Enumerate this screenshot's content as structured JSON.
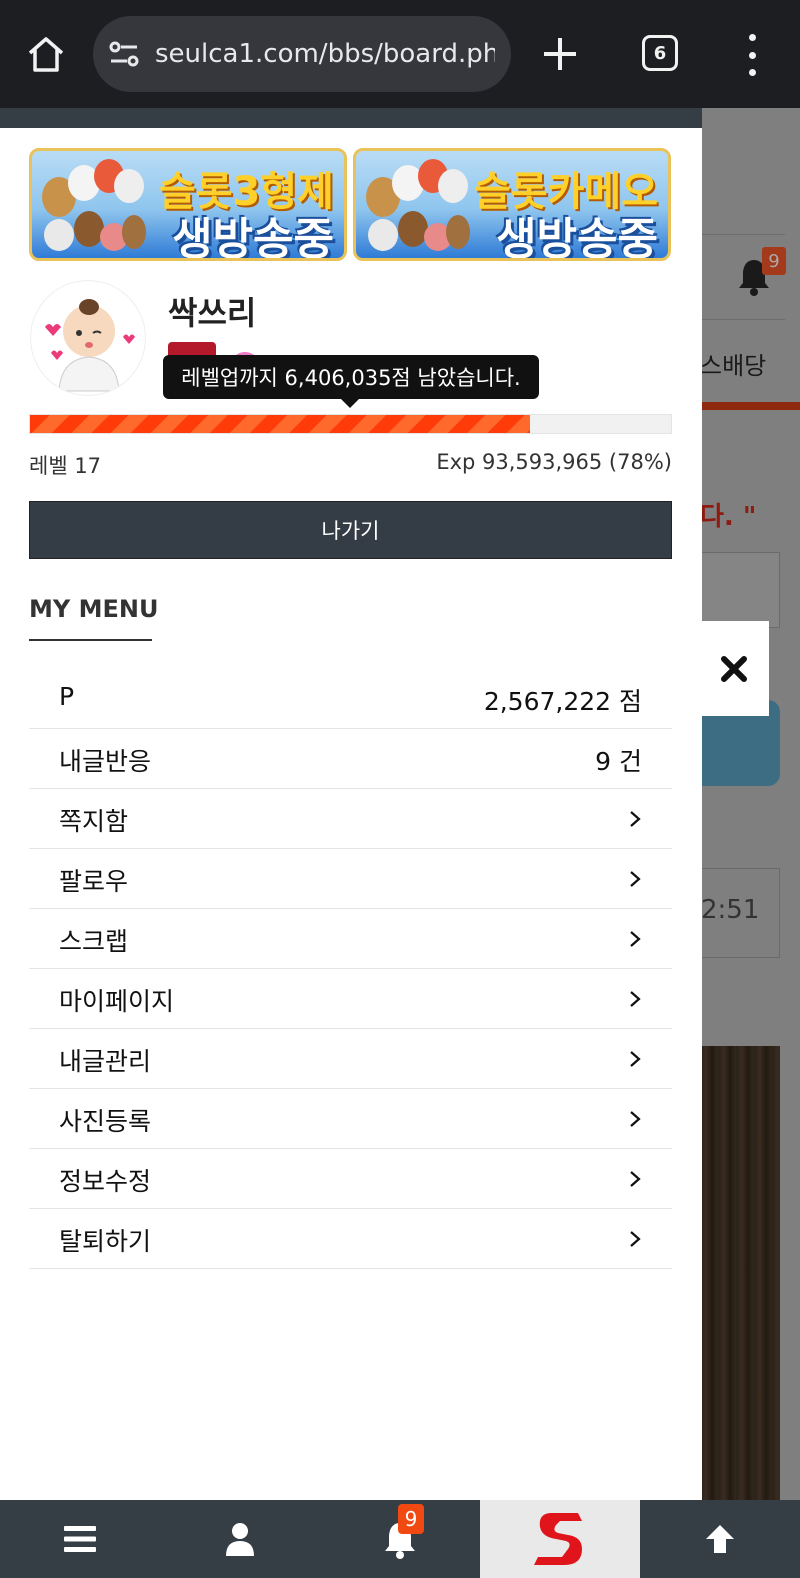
{
  "browser": {
    "url": "seulca1.com/bbs/board.php",
    "tab_count": "6"
  },
  "background_page": {
    "bell_count": "9",
    "nav_text": "스배당",
    "headline_fragment": "다. \"",
    "time_fragment": "2:51"
  },
  "banners": [
    {
      "line1": "슬롯3형제",
      "line2": "생방송중"
    },
    {
      "line1": "슬롯카메오",
      "line2": "생방송중"
    }
  ],
  "profile": {
    "username": "싹쓰리",
    "tooltip": "레벨업까지 6,406,035점 남았습니다.",
    "level_label": "레벨 17",
    "exp_label": "Exp 93,593,965 (78%)",
    "exp_percent": 78
  },
  "logout_label": "나가기",
  "my_menu": {
    "title": "MY MENU",
    "items": [
      {
        "label": "P",
        "value": "2,567,222 점"
      },
      {
        "label": "내글반응",
        "value": "9 건"
      },
      {
        "label": "쪽지함"
      },
      {
        "label": "팔로우"
      },
      {
        "label": "스크랩"
      },
      {
        "label": "마이페이지"
      },
      {
        "label": "내글관리"
      },
      {
        "label": "사진등록"
      },
      {
        "label": "정보수정"
      },
      {
        "label": "탈퇴하기"
      }
    ]
  },
  "bottom_nav": {
    "notification_count": "9"
  },
  "colors": {
    "accent_orange": "#ff3b0a",
    "dark_nav": "#353d45",
    "browser_bar": "#1d1e22"
  }
}
